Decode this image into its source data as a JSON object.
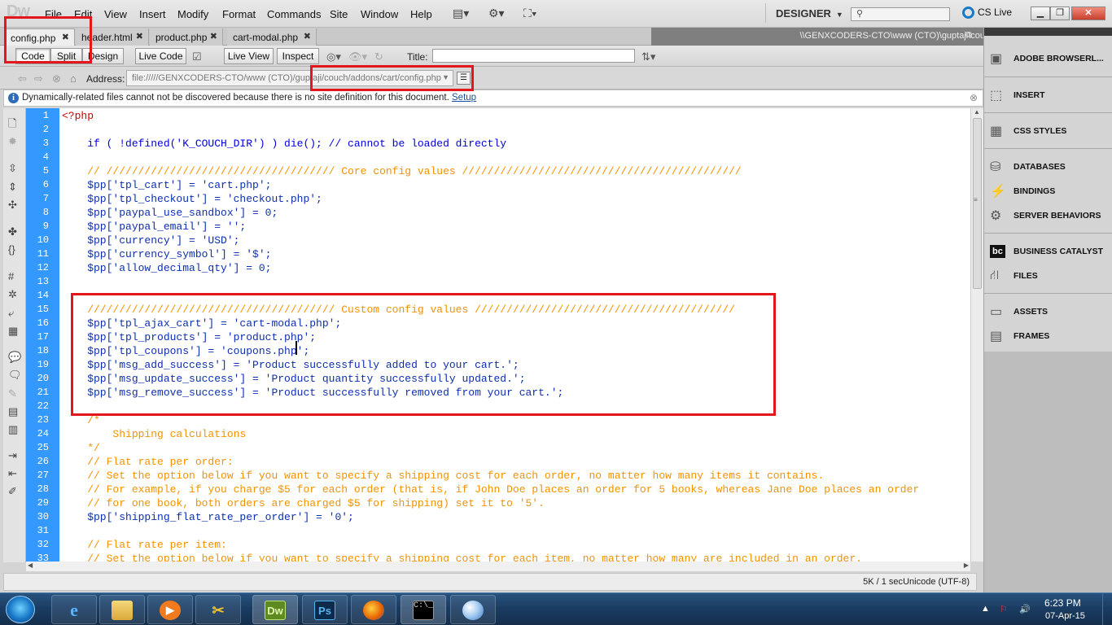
{
  "app": {
    "logo": "Dw",
    "menu": [
      "File",
      "Edit",
      "View",
      "Insert",
      "Modify",
      "Format",
      "Commands",
      "Site",
      "Window",
      "Help"
    ],
    "workspace": "DESIGNER",
    "cs_live": "CS Live"
  },
  "tabs": [
    {
      "label": "config.php",
      "active": true
    },
    {
      "label": "header.html",
      "active": false
    },
    {
      "label": "product.php",
      "active": false
    },
    {
      "label": "cart-modal.php",
      "active": false
    }
  ],
  "doc_path": "\\\\GENXCODERS-CTO\\www (CTO)\\guptaji\\couch\\addons\\cart\\config.php",
  "doc_toolbar": {
    "code": "Code",
    "split": "Split",
    "design": "Design",
    "live_code": "Live Code",
    "live_view": "Live View",
    "inspect": "Inspect",
    "title_label": "Title:",
    "title_value": ""
  },
  "address": {
    "label": "Address:",
    "value": "file://///GENXCODERS-CTO/www (CTO)/guptaji/couch/addons/cart/config.php"
  },
  "infobar": {
    "message": "Dynamically-related files cannot not be discovered because there is no site definition for this document.",
    "link": "Setup"
  },
  "code_lines": [
    "<?php",
    "",
    "    if ( !defined('K_COUCH_DIR') ) die(); // cannot be loaded directly",
    "",
    "    // //////////////////////////////////// Core config values ////////////////////////////////////////////",
    "    $pp['tpl_cart'] = 'cart.php';",
    "    $pp['tpl_checkout'] = 'checkout.php';",
    "    $pp['paypal_use_sandbox'] = 0;",
    "    $pp['paypal_email'] = '';",
    "    $pp['currency'] = 'USD';",
    "    $pp['currency_symbol'] = '$';",
    "    $pp['allow_decimal_qty'] = 0;",
    "",
    "",
    "    /////////////////////////////////////// Custom config values /////////////////////////////////////////",
    "    $pp['tpl_ajax_cart'] = 'cart-modal.php';",
    "    $pp['tpl_products'] = 'product.php';",
    "    $pp['tpl_coupons'] = 'coupons.php';",
    "    $pp['msg_add_success'] = 'Product successfully added to your cart.';",
    "    $pp['msg_update_success'] = 'Product quantity successfully updated.';",
    "    $pp['msg_remove_success'] = 'Product successfully removed from your cart.';",
    "",
    "    /*",
    "        Shipping calculations",
    "    */",
    "    // Flat rate per order:",
    "    // Set the option below if you want to specify a shipping cost for each order, no matter how many items it contains.",
    "    // For example, if you charge $5 for each order (that is, if John Doe places an order for 5 books, whereas Jane Doe places an order",
    "    // for one book, both orders are charged $5 for shipping) set it to '5'.",
    "    $pp['shipping_flat_rate_per_order'] = '0';",
    "",
    "    // Flat rate per item:",
    "    // Set the option below if you want to specify a shipping cost for each item, no matter how many are included in an order."
  ],
  "statusbar": {
    "size": "5K / 1 sec",
    "encoding": "Unicode (UTF-8)"
  },
  "panels": [
    {
      "label": "ADOBE BROWSERL...",
      "icon": "browserlab-icon"
    },
    {
      "label": "INSERT",
      "icon": "insert-icon"
    },
    {
      "label": "CSS STYLES",
      "icon": "css-styles-icon"
    },
    {
      "label": "DATABASES",
      "icon": "databases-icon"
    },
    {
      "label": "BINDINGS",
      "icon": "bindings-icon"
    },
    {
      "label": "SERVER BEHAVIORS",
      "icon": "server-behaviors-icon"
    },
    {
      "label": "BUSINESS CATALYST",
      "icon": "business-catalyst-icon"
    },
    {
      "label": "FILES",
      "icon": "files-icon"
    },
    {
      "label": "ASSETS",
      "icon": "assets-icon"
    },
    {
      "label": "FRAMES",
      "icon": "frames-icon"
    }
  ],
  "taskbar": {
    "apps": [
      {
        "name": "internet-explorer",
        "glyph": "e"
      },
      {
        "name": "windows-explorer",
        "glyph": ""
      },
      {
        "name": "media-player",
        "glyph": "▶"
      },
      {
        "name": "tool-app",
        "glyph": "✂"
      },
      {
        "name": "dreamweaver",
        "glyph": "Dw"
      },
      {
        "name": "photoshop",
        "glyph": "Ps"
      },
      {
        "name": "firefox",
        "glyph": ""
      },
      {
        "name": "command-prompt",
        "glyph": "C:\\_"
      },
      {
        "name": "paint",
        "glyph": ""
      }
    ],
    "time": "6:23 PM",
    "date": "07-Apr-15"
  }
}
